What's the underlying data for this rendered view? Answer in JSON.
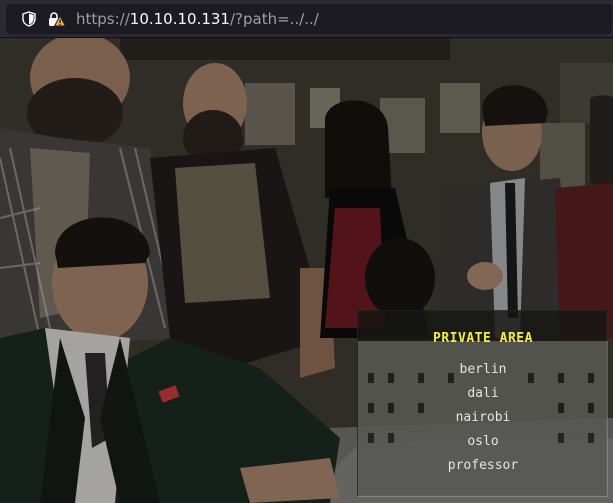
{
  "browser": {
    "url_scheme": "https://",
    "url_host": "10.10.10.131",
    "url_path": "/?path=../../"
  },
  "panel": {
    "title": "PRIVATE AREA",
    "items": [
      "berlin",
      "dali",
      "nairobi",
      "oslo",
      "professor"
    ],
    "title_color": "#f3ef3a"
  },
  "icons": {
    "security": "shield-icon",
    "connection": "insecure-lock-icon"
  }
}
